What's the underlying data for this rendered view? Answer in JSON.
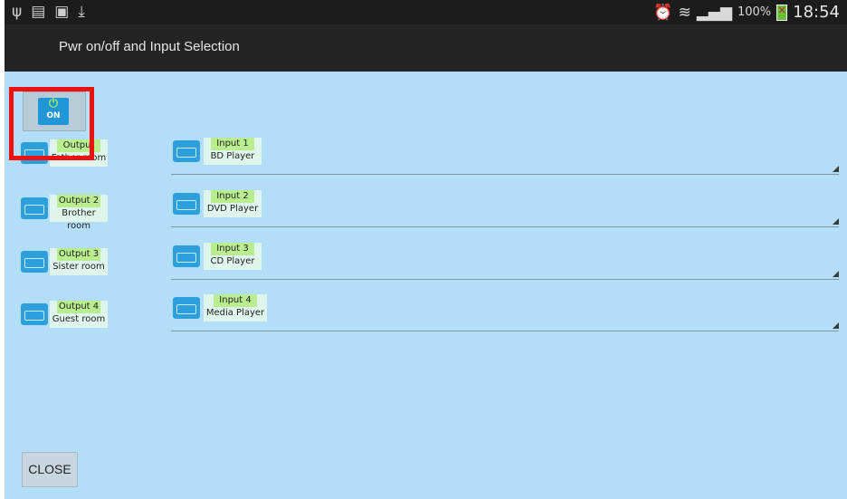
{
  "status_bar": {
    "left_icons": [
      "usb-icon",
      "sim-icon",
      "image-icon",
      "download-icon"
    ],
    "right_icons": [
      "alarm-icon",
      "wifi-icon",
      "signal-icon",
      "battery-icon"
    ],
    "battery_percent": "100%",
    "time": "18:54"
  },
  "title_bar": {
    "title": "Pwr on/off and Input Selection"
  },
  "power": {
    "state_label": "ON",
    "icon": "power-icon"
  },
  "outputs": [
    {
      "tag": "Output",
      "room": "Father room"
    },
    {
      "tag": "Output 2",
      "room": "Brother room"
    },
    {
      "tag": "Output 3",
      "room": "Sister room"
    },
    {
      "tag": "Output 4",
      "room": "Guest room"
    }
  ],
  "inputs": [
    {
      "tag": "Input 1",
      "device": "BD Player"
    },
    {
      "tag": "Input 2",
      "device": "DVD Player"
    },
    {
      "tag": "Input 3",
      "device": "CD Player"
    },
    {
      "tag": "Input 4",
      "device": "Media Player"
    }
  ],
  "close_label": "CLOSE",
  "colors": {
    "background": "#b3def7",
    "icon_blue": "#2d9fdc",
    "label_green": "#b9ed8f",
    "highlight_red": "#ee1111"
  }
}
